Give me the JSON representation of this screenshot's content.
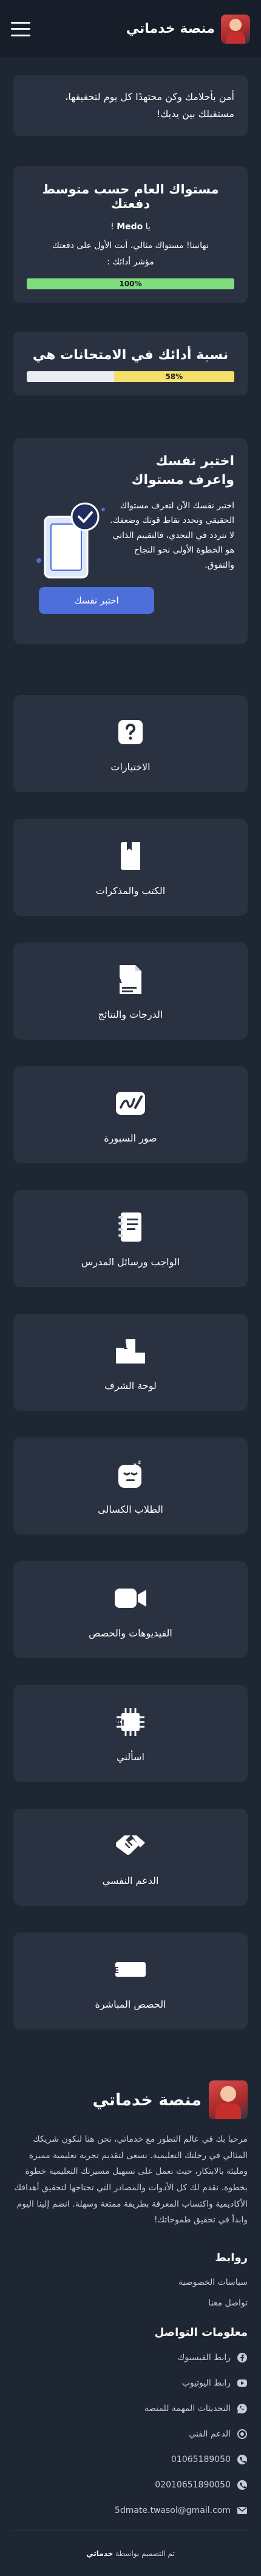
{
  "header": {
    "brand": "منصة خدماتي",
    "menu_icon": "hamburger-icon"
  },
  "hero": {
    "text": "أمن بأحلامك وكن محتهدًا كل يوم لتحقيقها، مستقبلك بين يديك!"
  },
  "level_card": {
    "title": "مستواك العام حسب متوسط دفعتك",
    "greeting_prefix": "يا",
    "user_name": "Medo",
    "greeting_suffix": "!",
    "congrats": "تهانينا! مستواك مثالي، أنت الأول على دفعتك",
    "indicator_label": "مؤشر أدائك :",
    "progress": 100,
    "progress_text": "100%",
    "bar_color": "#7fdc7f"
  },
  "exams_card": {
    "title": "نسبة أدائك في الامتحانات هي",
    "progress": 58,
    "progress_text": "58%",
    "bar_color": "#f2e06b"
  },
  "promo": {
    "title": "اختبر نفسك واعرف مستواك",
    "body": "اختبر نفسك الآن لتعرف مستواك الحقيقي وتحدد نقاط قوتك وضعفك. لا تتردد في التحدي، فالتقييم الذاتي هو الخطوة الأولى نحو النجاح والتفوق.",
    "button": "اختبر نفسك",
    "illustration_icon": "tablet-check-icon",
    "accent": "#4c6fd9"
  },
  "services": [
    {
      "label": "الاختبارات",
      "icon": "question-icon"
    },
    {
      "label": "الكتب والمذكرات",
      "icon": "book-icon"
    },
    {
      "label": "الدرجات والنتائج",
      "icon": "grade-icon"
    },
    {
      "label": "صور السبورة",
      "icon": "whiteboard-icon"
    },
    {
      "label": "الواجب ورسائل المدرس",
      "icon": "notebook-icon"
    },
    {
      "label": "لوحة الشرف",
      "icon": "podium-icon"
    },
    {
      "label": "الطلاب الكسالى",
      "icon": "lazy-student-icon"
    },
    {
      "label": "الفيديوهات والحصص",
      "icon": "video-icon"
    },
    {
      "label": "اسألني",
      "icon": "ai-chip-icon"
    },
    {
      "label": "الدعم النفسي",
      "icon": "handshake-icon"
    },
    {
      "label": "الحصص المباشرة",
      "icon": "live-icon"
    }
  ],
  "footer": {
    "brand": "منصة خدماتي",
    "about": "مرحبا بك في عالم التطور مع خدماتي، نحن هنا لنكون شريكك المثالي في رحلتك التعليمية. نسعى لتقديم تجربة تعليمية مميزة ومليئة بالابتكار، حيث نعمل على تسهيل مسيرتك التعليمية خطوة بخطوة. نقدم لك كل الأدوات والمصادر التي تحتاجها لتحقيق أهدافك الأكاديمية واكتساب المعرفة بطريقة ممتعة وسهلة. انضم إلينا اليوم وابدأ في تحقيق طموحاتك!",
    "links_title": "روابط",
    "links": [
      "سياسات الخصوصية",
      "تواصل معنا"
    ],
    "contact_title": "معلومات التواصل",
    "contacts": [
      {
        "label": "رابط الفيسبوك",
        "icon": "facebook-icon"
      },
      {
        "label": "رابط اليوتيوب",
        "icon": "youtube-icon"
      },
      {
        "label": "التحديثات المهمة للمنصة",
        "icon": "whatsapp-icon"
      },
      {
        "label": "الدعم الفني",
        "icon": "support-icon"
      },
      {
        "label": "01065189050",
        "icon": "phone-icon"
      },
      {
        "label": "02010651890050",
        "icon": "phone-icon"
      },
      {
        "label": "5dmate.twasol@gmail.com",
        "icon": "mail-icon"
      }
    ],
    "copyright_prefix": "تم التصميم بواسطة",
    "copyright_brand": "خدماتي"
  }
}
